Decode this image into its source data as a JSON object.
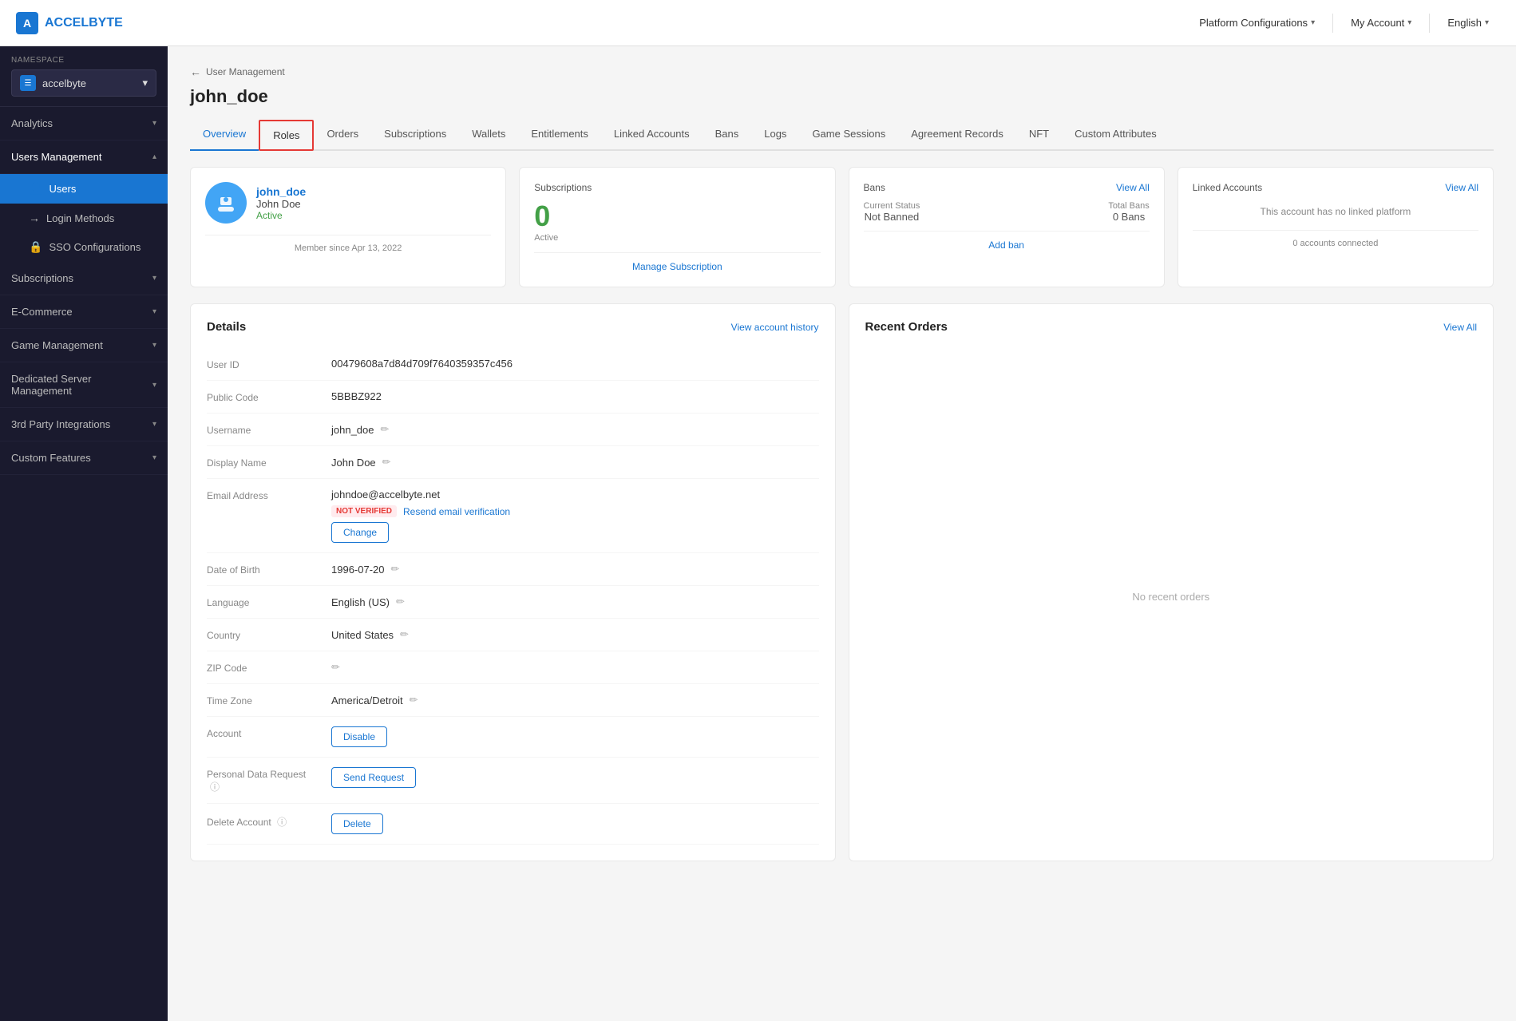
{
  "topNav": {
    "logo_text": "ACCELBYTE",
    "platform_configs_label": "Platform Configurations",
    "my_account_label": "My Account",
    "language_label": "English"
  },
  "sidebar": {
    "namespace_label": "NAMESPACE",
    "namespace_value": "accelbyte",
    "nav_items": [
      {
        "id": "analytics",
        "label": "Analytics",
        "expanded": false
      },
      {
        "id": "users-management",
        "label": "Users Management",
        "expanded": true
      },
      {
        "id": "subscriptions",
        "label": "Subscriptions",
        "expanded": false
      },
      {
        "id": "ecommerce",
        "label": "E-Commerce",
        "expanded": false
      },
      {
        "id": "game-management",
        "label": "Game Management",
        "expanded": false
      },
      {
        "id": "dedicated-server",
        "label": "Dedicated Server Management",
        "expanded": false
      },
      {
        "id": "3rd-party",
        "label": "3rd Party Integrations",
        "expanded": false
      },
      {
        "id": "custom-features",
        "label": "Custom Features",
        "expanded": false
      }
    ],
    "users_sub_items": [
      {
        "id": "users",
        "label": "Users",
        "icon": "👤",
        "active": true
      },
      {
        "id": "login-methods",
        "label": "Login Methods",
        "icon": "🔑",
        "active": false
      },
      {
        "id": "sso-config",
        "label": "SSO Configurations",
        "icon": "🔒",
        "active": false
      }
    ]
  },
  "breadcrumb": {
    "back_label": "User Management"
  },
  "page": {
    "title": "john_doe"
  },
  "tabs": [
    {
      "id": "overview",
      "label": "Overview",
      "active": true,
      "highlight": false
    },
    {
      "id": "roles",
      "label": "Roles",
      "active": false,
      "highlight": true
    },
    {
      "id": "orders",
      "label": "Orders",
      "active": false,
      "highlight": false
    },
    {
      "id": "subscriptions",
      "label": "Subscriptions",
      "active": false,
      "highlight": false
    },
    {
      "id": "wallets",
      "label": "Wallets",
      "active": false,
      "highlight": false
    },
    {
      "id": "entitlements",
      "label": "Entitlements",
      "active": false,
      "highlight": false
    },
    {
      "id": "linked-accounts",
      "label": "Linked Accounts",
      "active": false,
      "highlight": false
    },
    {
      "id": "bans",
      "label": "Bans",
      "active": false,
      "highlight": false
    },
    {
      "id": "logs",
      "label": "Logs",
      "active": false,
      "highlight": false
    },
    {
      "id": "game-sessions",
      "label": "Game Sessions",
      "active": false,
      "highlight": false
    },
    {
      "id": "agreement-records",
      "label": "Agreement Records",
      "active": false,
      "highlight": false
    },
    {
      "id": "nft",
      "label": "NFT",
      "active": false,
      "highlight": false
    },
    {
      "id": "custom-attributes",
      "label": "Custom Attributes",
      "active": false,
      "highlight": false
    }
  ],
  "user_card": {
    "username_link": "john_doe",
    "full_name": "John Doe",
    "status": "Active",
    "member_since": "Member since Apr 13, 2022"
  },
  "subscriptions_card": {
    "title": "Subscriptions",
    "count": "0",
    "sublabel": "Active",
    "action_label": "Manage Subscription"
  },
  "bans_card": {
    "title": "Bans",
    "view_all": "View All",
    "current_status_label": "Current Status",
    "current_status_value": "Not Banned",
    "total_bans_label": "Total Bans",
    "total_bans_value": "0 Bans",
    "add_ban_label": "Add ban"
  },
  "linked_accounts_card": {
    "title": "Linked Accounts",
    "view_all": "View All",
    "empty_message": "This account has no linked platform",
    "count_label": "0 accounts connected"
  },
  "details": {
    "title": "Details",
    "view_history_label": "View account history",
    "fields": [
      {
        "id": "user-id",
        "label": "User ID",
        "value": "00479608a7d84d709f7640359357c456",
        "editable": false
      },
      {
        "id": "public-code",
        "label": "Public Code",
        "value": "5BBBZ922",
        "editable": false
      },
      {
        "id": "username",
        "label": "Username",
        "value": "john_doe",
        "editable": true
      },
      {
        "id": "display-name",
        "label": "Display Name",
        "value": "John Doe",
        "editable": true
      },
      {
        "id": "email",
        "label": "Email Address",
        "value": "johndoe@accelbyte.net",
        "editable": false,
        "special": "email"
      },
      {
        "id": "dob",
        "label": "Date of Birth",
        "value": "1996-07-20",
        "editable": true
      },
      {
        "id": "language",
        "label": "Language",
        "value": "English (US)",
        "editable": true
      },
      {
        "id": "country",
        "label": "Country",
        "value": "United States",
        "editable": true
      },
      {
        "id": "zip-code",
        "label": "ZIP Code",
        "value": "",
        "editable": true
      },
      {
        "id": "timezone",
        "label": "Time Zone",
        "value": "America/Detroit",
        "editable": true
      },
      {
        "id": "account",
        "label": "Account",
        "value": "",
        "special": "account"
      },
      {
        "id": "personal-data",
        "label": "Personal Data Request",
        "value": "",
        "special": "personal-data"
      },
      {
        "id": "delete-account",
        "label": "Delete Account",
        "value": "",
        "special": "delete-account"
      }
    ],
    "not_verified_label": "NOT VERIFIED",
    "resend_label": "Resend email verification",
    "change_btn": "Change",
    "disable_btn": "Disable",
    "send_request_btn": "Send Request",
    "delete_btn": "Delete"
  },
  "recent_orders": {
    "title": "Recent Orders",
    "view_all_label": "View All",
    "empty_label": "No recent orders"
  }
}
